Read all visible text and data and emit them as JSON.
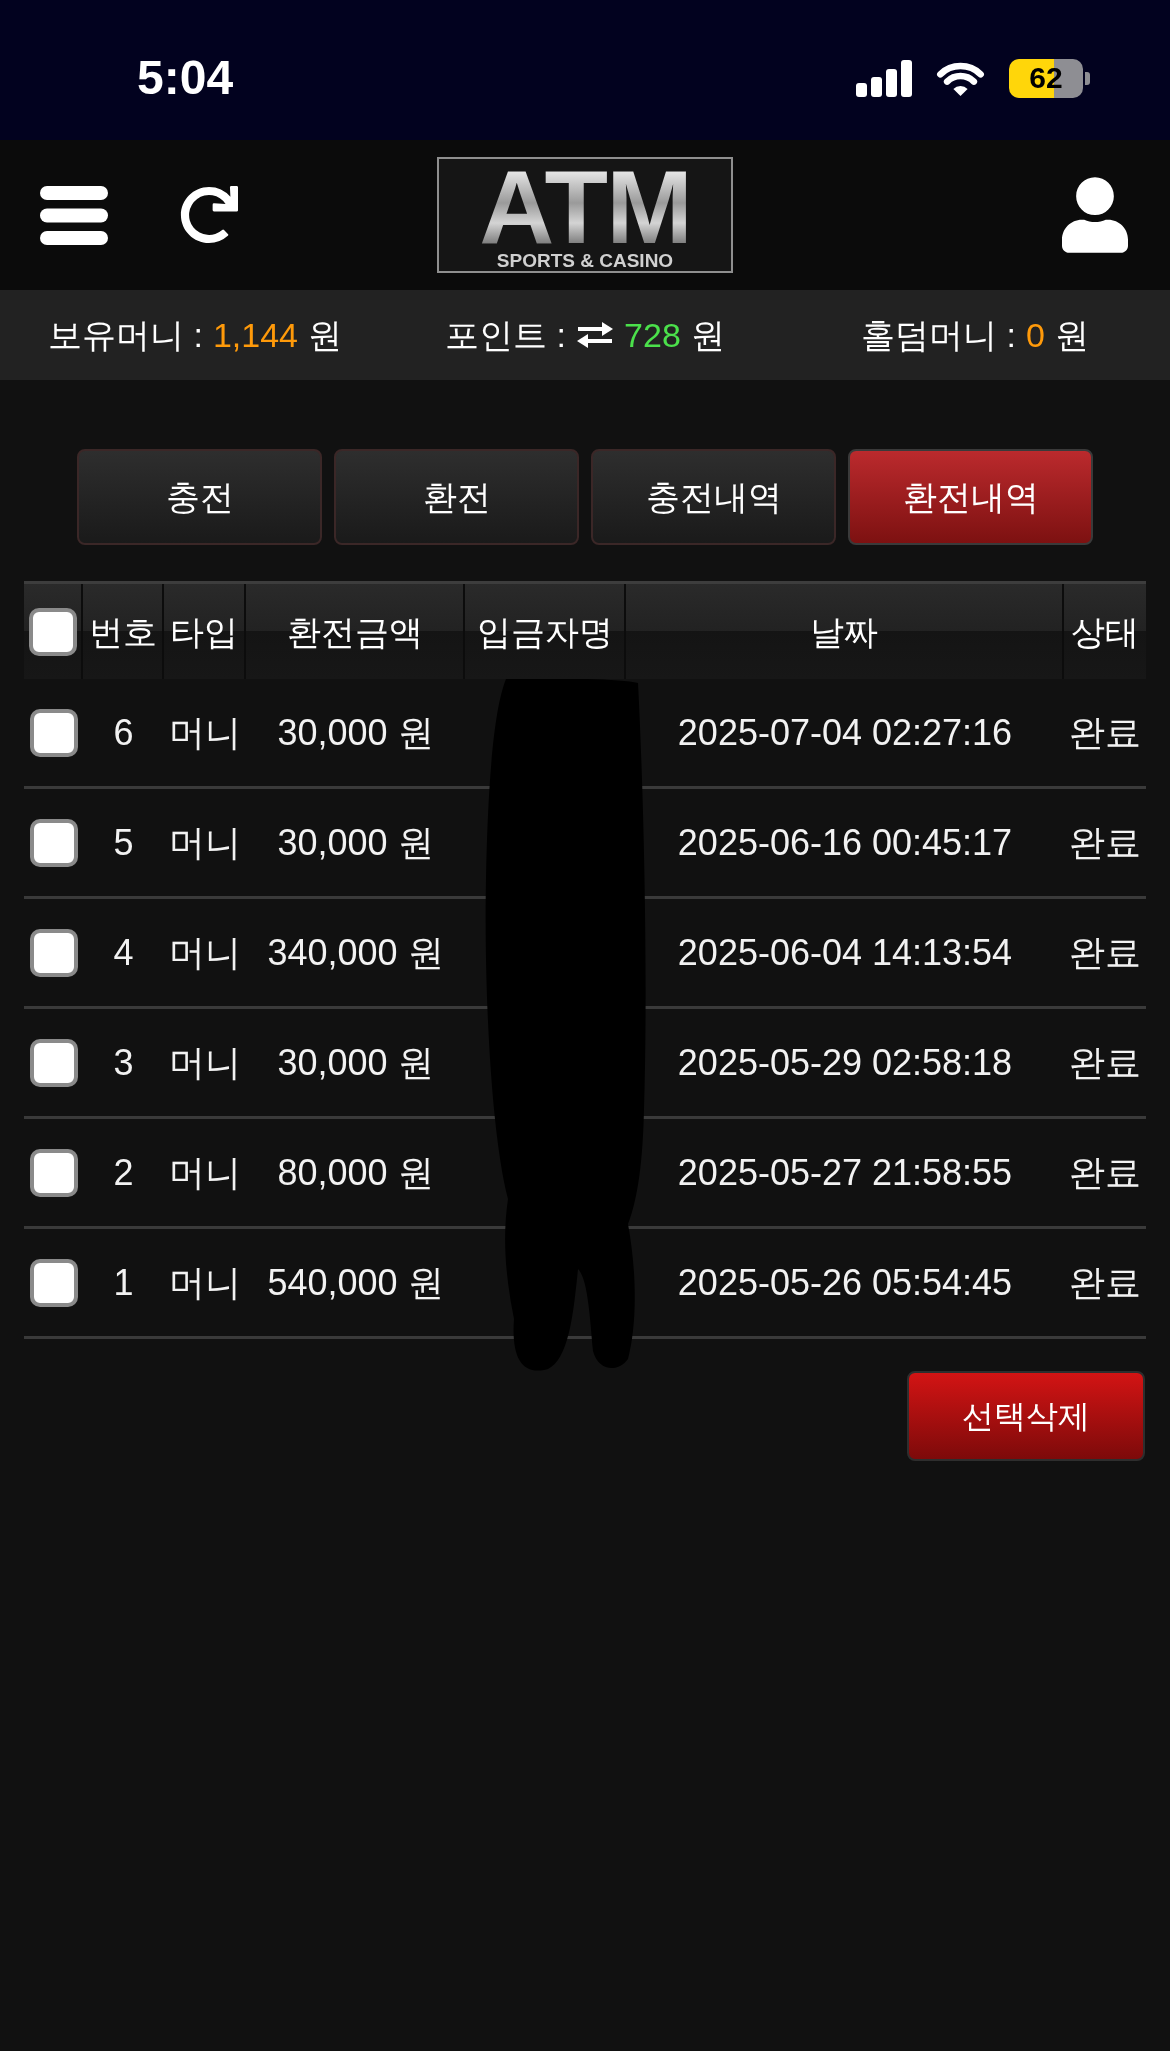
{
  "status_bar": {
    "time": "5:04",
    "battery": "62"
  },
  "header": {
    "logo": {
      "title": "ATM",
      "subtitle": "SPORTS & CASINO"
    }
  },
  "balances": [
    {
      "kind": "plain",
      "label": "보유머니 :",
      "value": "1,144",
      "unit": "원",
      "color": "#ff9a0a"
    },
    {
      "kind": "exchange",
      "label": "포인트 :",
      "value": "728",
      "unit": "원",
      "color": "#4be04b"
    },
    {
      "kind": "plain",
      "label": "홀덤머니 :",
      "value": "0",
      "unit": "원",
      "color": "#ff9a0a"
    }
  ],
  "tabs": [
    {
      "label": "충전",
      "selected": false
    },
    {
      "label": "환전",
      "selected": false
    },
    {
      "label": "충전내역",
      "selected": false
    },
    {
      "label": "환전내역",
      "selected": true
    }
  ],
  "table": {
    "select_all": {
      "checked": false
    },
    "columns": [
      "번호",
      "타입",
      "환전금액",
      "입금자명",
      "날짜",
      "상태"
    ],
    "rows": [
      {
        "checked": false,
        "number": "6",
        "type": "머니",
        "amount": "30,000 원",
        "date": "2025-07-04 02:27:16",
        "status": "완료"
      },
      {
        "checked": false,
        "number": "5",
        "type": "머니",
        "amount": "30,000 원",
        "date": "2025-06-16 00:45:17",
        "status": "완료"
      },
      {
        "checked": false,
        "number": "4",
        "type": "머니",
        "amount": "340,000 원",
        "date": "2025-06-04 14:13:54",
        "status": "완료"
      },
      {
        "checked": false,
        "number": "3",
        "type": "머니",
        "amount": "30,000 원",
        "date": "2025-05-29 02:58:18",
        "status": "완료"
      },
      {
        "checked": false,
        "number": "2",
        "type": "머니",
        "amount": "80,000 원",
        "date": "2025-05-27 21:58:55",
        "status": "완료"
      },
      {
        "checked": false,
        "number": "1",
        "type": "머니",
        "amount": "540,000 원",
        "date": "2025-05-26 05:54:45",
        "status": "완료"
      }
    ]
  },
  "delete_button": {
    "label": "선택삭제"
  }
}
